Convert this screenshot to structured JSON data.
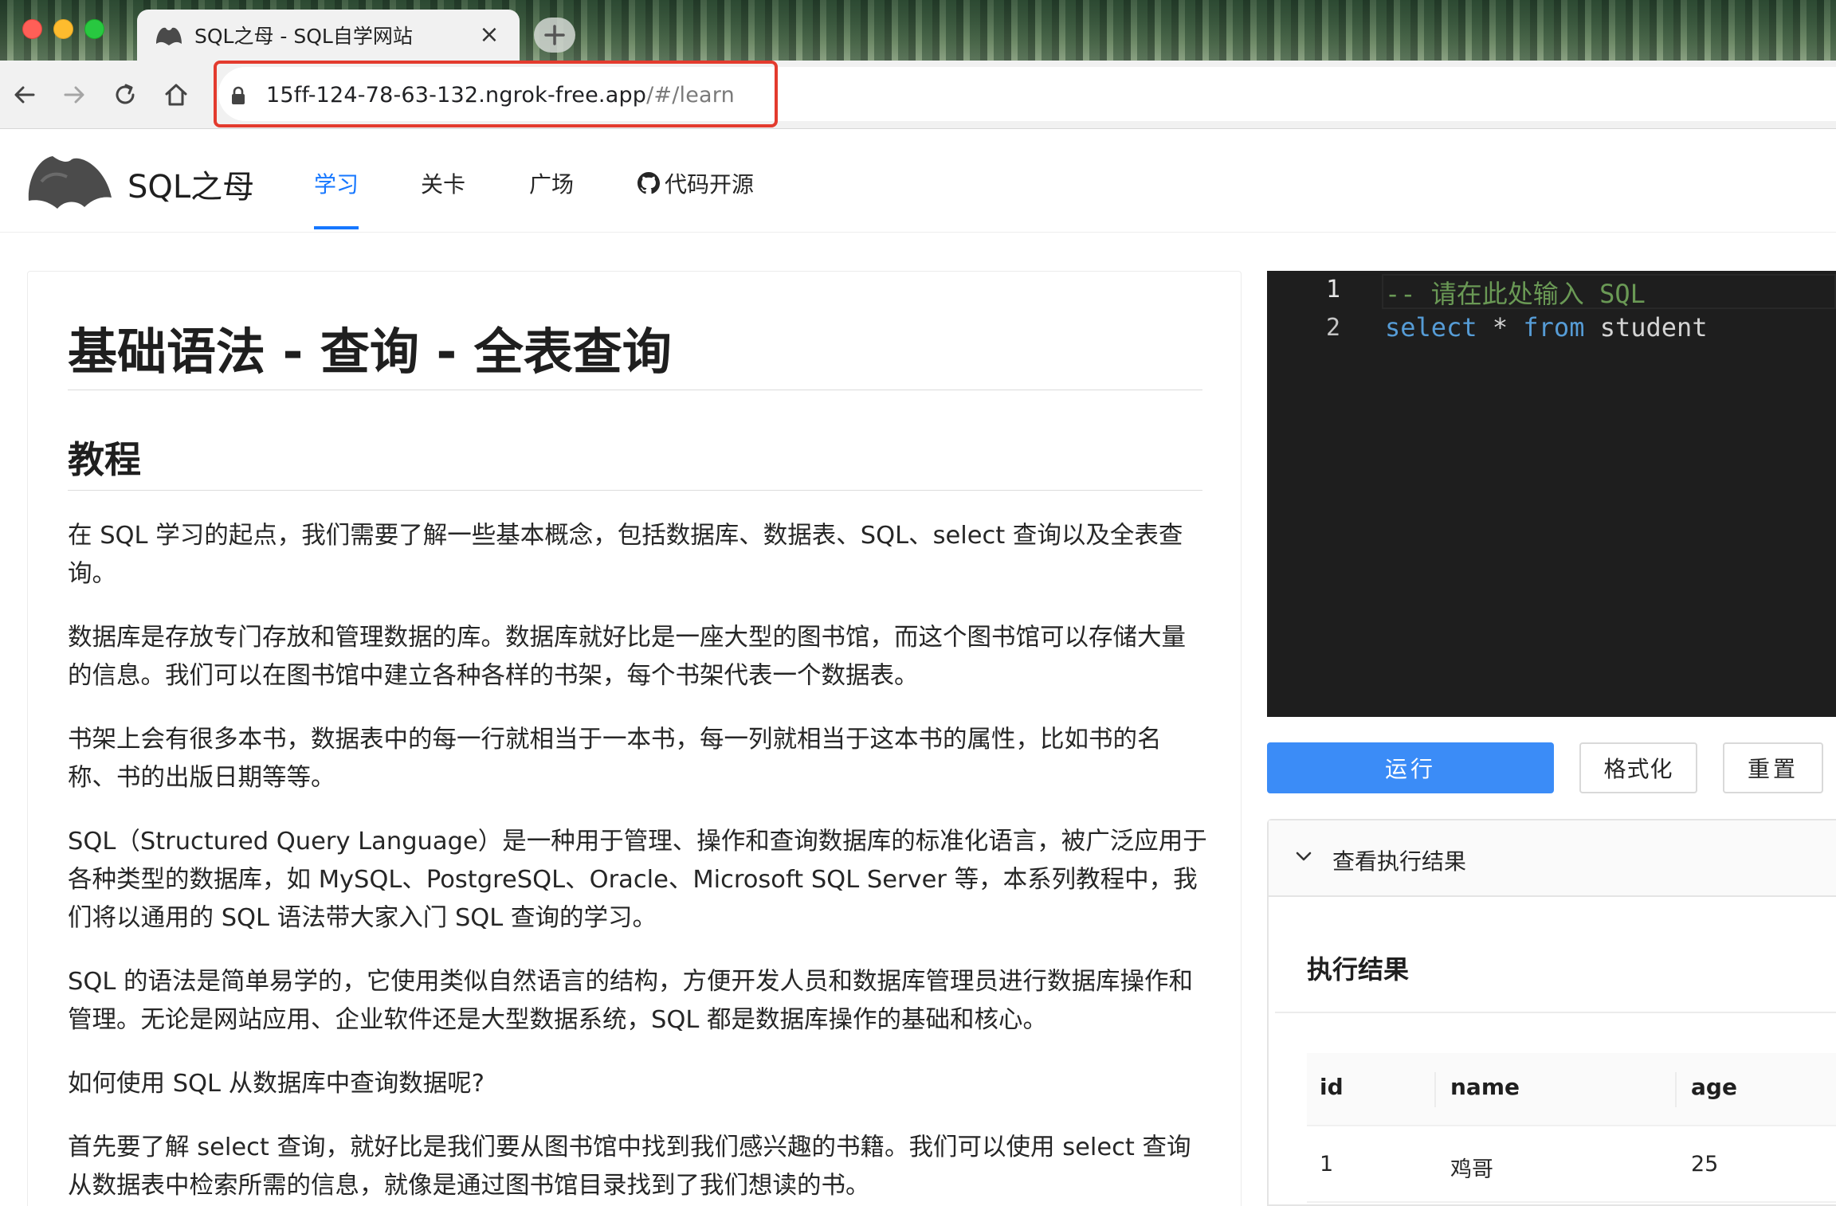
{
  "browser": {
    "tab_title": "SQL之母 - SQL自学网站",
    "url_host": "15ff-124-78-63-132.ngrok-free.app",
    "url_path": "/#/learn"
  },
  "header": {
    "logo_text": "SQL之母",
    "nav": [
      "学习",
      "关卡",
      "广场",
      "代码开源"
    ]
  },
  "article": {
    "title": "基础语法 - 查询 - 全表查询",
    "section_title": "教程",
    "paragraphs": [
      "在 SQL 学习的起点，我们需要了解一些基本概念，包括数据库、数据表、SQL、select 查询以及全表查询。",
      "数据库是存放专门存放和管理数据的库。数据库就好比是一座大型的图书馆，而这个图书馆可以存储大量的信息。我们可以在图书馆中建立各种各样的书架，每个书架代表一个数据表。",
      "书架上会有很多本书，数据表中的每一行就相当于一本书，每一列就相当于这本书的属性，比如书的名称、书的出版日期等等。",
      "SQL（Structured Query Language）是一种用于管理、操作和查询数据库的标准化语言，被广泛应用于各种类型的数据库，如 MySQL、PostgreSQL、Oracle、Microsoft SQL Server 等，本系列教程中，我们将以通用的 SQL 语法带大家入门 SQL 查询的学习。",
      "SQL 的语法是简单易学的，它使用类似自然语言的结构，方便开发人员和数据库管理员进行数据库操作和管理。无论是网站应用、企业软件还是大型数据系统，SQL 都是数据库操作的基础和核心。",
      "如何使用 SQL 从数据库中查询数据呢?",
      "首先要了解 select 查询，就好比是我们要从图书馆中找到我们感兴趣的书籍。我们可以使用 select 查询从数据表中检索所需的信息，就像是通过图书馆目录找到了我们想读的书。"
    ]
  },
  "editor": {
    "line_numbers": [
      "1",
      "2"
    ],
    "line1_comment": "-- 请在此处输入 SQL",
    "line2": {
      "kw1": "select",
      "op": "*",
      "kw2": "from",
      "ident": "student"
    }
  },
  "buttons": {
    "run": "运行",
    "format": "格式化",
    "reset": "重置"
  },
  "result": {
    "collapse_label": "查看执行结果",
    "title": "执行结果",
    "columns": [
      "id",
      "name",
      "age"
    ],
    "rows": [
      [
        "1",
        "鸡哥",
        "25"
      ]
    ]
  },
  "colors": {
    "accent": "#1677ff",
    "run_button": "#3b8cf7",
    "url_highlight": "#e33b2e"
  }
}
